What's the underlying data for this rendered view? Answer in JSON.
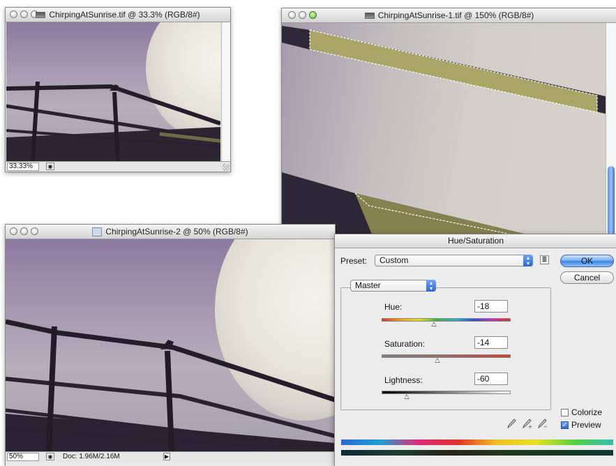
{
  "windows": {
    "small": {
      "title": "ChirpingAtSunrise.tif @ 33.3% (RGB/8#)",
      "zoom": "33.33%"
    },
    "zoomed": {
      "title": "ChirpingAtSunrise-1.tif @ 150% (RGB/8#)"
    },
    "large": {
      "title": "ChirpingAtSunrise-2 @ 50% (RGB/8#)",
      "zoom": "50%",
      "doc_info": "Doc: 1.96M/2.16M"
    }
  },
  "dialog": {
    "title": "Hue/Saturation",
    "preset_label": "Preset:",
    "preset_value": "Custom",
    "edit_value": "Master",
    "ok_label": "OK",
    "cancel_label": "Cancel",
    "hue": {
      "label": "Hue:",
      "value": "-18",
      "level": -18,
      "range": [
        -180,
        180
      ]
    },
    "saturation": {
      "label": "Saturation:",
      "value": "-14",
      "level": -14,
      "range": [
        -100,
        100
      ]
    },
    "lightness": {
      "label": "Lightness:",
      "value": "-60",
      "level": -60,
      "range": [
        -100,
        100
      ]
    },
    "colorize": {
      "label": "Colorize",
      "checked": false
    },
    "preview": {
      "label": "Preview",
      "checked": true
    },
    "icons": [
      "preset-options-icon",
      "eyedropper-icon",
      "eyedropper-plus-icon",
      "eyedropper-minus-icon"
    ]
  },
  "colors": {
    "accent": "#3f82e0",
    "photo_purple": "#8d7aa0",
    "photo_highlight": "#ecebe3",
    "selection_olive": "#a9a567"
  }
}
